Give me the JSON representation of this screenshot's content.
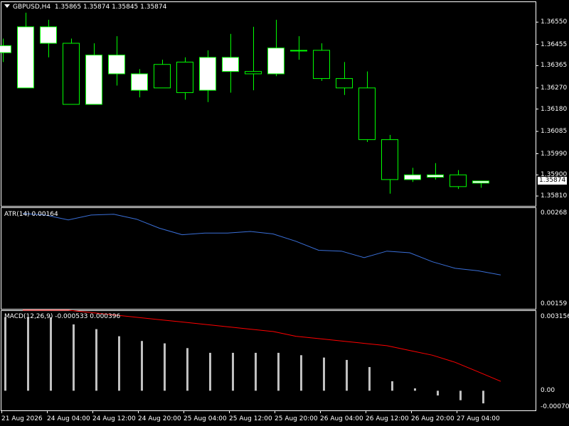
{
  "main_header": {
    "symbol": "GBPUSD,H4",
    "values": "1.35865 1.35874 1.35845 1.35874"
  },
  "atr_header": {
    "label": "ATR(14) 0.00164"
  },
  "macd_header": {
    "label": "MACD(12,26,9) -0.000533 0.000396"
  },
  "current_price": "1.35874",
  "colors": {
    "background": "#000000",
    "frame": "#ffffff",
    "candle_bull_body": "#ffffff",
    "candle_outline": "#00ff00",
    "atr_line": "#3a6fd8",
    "macd_hist": "#c0c0c0",
    "macd_signal": "#ff0000"
  },
  "chart_data": [
    {
      "type": "candlestick",
      "symbol": "GBPUSD",
      "timeframe": "H4",
      "y_ticks": [
        "1.36550",
        "1.36455",
        "1.36365",
        "1.36270",
        "1.36180",
        "1.36085",
        "1.35990",
        "1.35900",
        "1.35810"
      ],
      "ylim": [
        1.3578,
        1.3662
      ],
      "x_ticks": [
        "21 Aug 2026",
        "24 Aug 04:00",
        "24 Aug 12:00",
        "24 Aug 20:00",
        "25 Aug 04:00",
        "25 Aug 12:00",
        "25 Aug 20:00",
        "26 Aug 04:00",
        "26 Aug 12:00",
        "26 Aug 20:00",
        "27 Aug 04:00"
      ],
      "candles": [
        {
          "o": 1.3642,
          "h": 1.3648,
          "l": 1.3638,
          "c": 1.3645
        },
        {
          "o": 1.3627,
          "h": 1.3659,
          "l": 1.3627,
          "c": 1.3653
        },
        {
          "o": 1.3646,
          "h": 1.3656,
          "l": 1.364,
          "c": 1.3653
        },
        {
          "o": 1.3646,
          "h": 1.3648,
          "l": 1.362,
          "c": 1.362
        },
        {
          "o": 1.362,
          "h": 1.3646,
          "l": 1.362,
          "c": 1.3641
        },
        {
          "o": 1.3633,
          "h": 1.3649,
          "l": 1.3628,
          "c": 1.3641
        },
        {
          "o": 1.3626,
          "h": 1.3635,
          "l": 1.3623,
          "c": 1.3633
        },
        {
          "o": 1.3637,
          "h": 1.3639,
          "l": 1.3627,
          "c": 1.3627
        },
        {
          "o": 1.3638,
          "h": 1.364,
          "l": 1.3622,
          "c": 1.3625
        },
        {
          "o": 1.3626,
          "h": 1.3643,
          "l": 1.3621,
          "c": 1.364
        },
        {
          "o": 1.3634,
          "h": 1.365,
          "l": 1.3625,
          "c": 1.364
        },
        {
          "o": 1.3634,
          "h": 1.3653,
          "l": 1.3626,
          "c": 1.3633
        },
        {
          "o": 1.3633,
          "h": 1.3656,
          "l": 1.3632,
          "c": 1.3644
        },
        {
          "o": 1.3643,
          "h": 1.3649,
          "l": 1.3639,
          "c": 1.3643
        },
        {
          "o": 1.3643,
          "h": 1.3646,
          "l": 1.363,
          "c": 1.3631
        },
        {
          "o": 1.3631,
          "h": 1.3638,
          "l": 1.3624,
          "c": 1.3627
        },
        {
          "o": 1.3627,
          "h": 1.3634,
          "l": 1.3604,
          "c": 1.3605
        },
        {
          "o": 1.3605,
          "h": 1.3607,
          "l": 1.3582,
          "c": 1.3588
        },
        {
          "o": 1.3588,
          "h": 1.3593,
          "l": 1.3587,
          "c": 1.359
        },
        {
          "o": 1.3589,
          "h": 1.3595,
          "l": 1.3588,
          "c": 1.359
        },
        {
          "o": 1.359,
          "h": 1.3592,
          "l": 1.3584,
          "c": 1.3585
        },
        {
          "o": 1.35865,
          "h": 1.35874,
          "l": 1.35845,
          "c": 1.35874
        }
      ]
    },
    {
      "type": "line",
      "name": "ATR(14)",
      "y_ticks": [
        "0.00268",
        "0.00159"
      ],
      "ylim": [
        0.00155,
        0.00272
      ],
      "values": [
        0.00268,
        0.00266,
        0.0026,
        0.00266,
        0.00267,
        0.00261,
        0.0025,
        0.00242,
        0.00244,
        0.00244,
        0.00246,
        0.00243,
        0.00234,
        0.00223,
        0.00222,
        0.00214,
        0.00222,
        0.0022,
        0.00209,
        0.00201,
        0.00198,
        0.00193
      ]
    },
    {
      "type": "bar+line",
      "name": "MACD(12,26,9)",
      "y_ticks": [
        "0.003156",
        "0.00",
        "-0.000709"
      ],
      "ylim": [
        -0.000709,
        0.003156
      ],
      "series": [
        {
          "name": "MACD",
          "type": "bar",
          "values": [
            0.0031,
            0.0031,
            0.0031,
            0.0028,
            0.0026,
            0.0023,
            0.0021,
            0.002,
            0.0018,
            0.0016,
            0.0016,
            0.0016,
            0.0016,
            0.0015,
            0.0014,
            0.0013,
            0.001,
            0.0004,
            0.0001,
            -0.0002,
            -0.0004,
            -0.000533
          ]
        },
        {
          "name": "Signal",
          "type": "line",
          "values": [
            0.0034,
            0.0034,
            0.0034,
            0.0033,
            0.0032,
            0.0031,
            0.003,
            0.0029,
            0.0028,
            0.0027,
            0.0026,
            0.0025,
            0.0023,
            0.0022,
            0.0021,
            0.002,
            0.0019,
            0.0017,
            0.0015,
            0.0012,
            0.0008,
            0.000396
          ]
        }
      ]
    }
  ]
}
